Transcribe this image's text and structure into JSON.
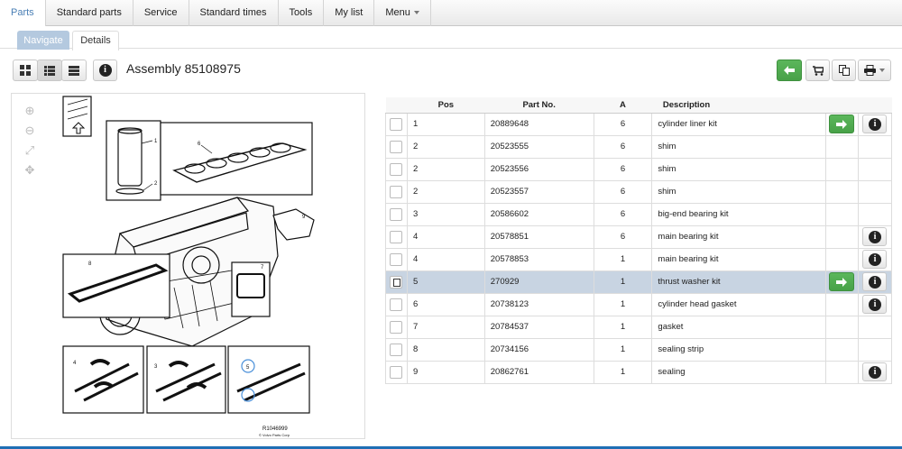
{
  "nav": {
    "tabs": [
      {
        "label": "Parts",
        "active": true
      },
      {
        "label": "Standard parts"
      },
      {
        "label": "Service"
      },
      {
        "label": "Standard times"
      },
      {
        "label": "Tools"
      },
      {
        "label": "My list"
      },
      {
        "label": "Menu",
        "dropdown": true
      }
    ]
  },
  "subtabs": {
    "navigate": "Navigate",
    "details": "Details"
  },
  "toolbar": {
    "view_icons": [
      "grid-view-icon",
      "list-view-icon",
      "compact-list-icon"
    ],
    "title": "Assembly 85108975",
    "right_icons": [
      "back-arrow-icon",
      "cart-icon",
      "copy-icon",
      "print-icon"
    ]
  },
  "drawing": {
    "code": "R1046999",
    "copyright": "© Volvo Parts Corp",
    "zoom_icons": [
      "zoom-in-icon",
      "zoom-out-icon",
      "fit-icon",
      "move-icon"
    ],
    "callouts": [
      "1",
      "2",
      "6",
      "9",
      "8",
      "7",
      "4",
      "3",
      "5"
    ]
  },
  "table": {
    "columns": {
      "pos": "Pos",
      "part": "Part No.",
      "a": "A",
      "desc": "Description"
    },
    "rows": [
      {
        "pos": "1",
        "part": "20889648",
        "a": "6",
        "desc": "cylinder liner kit",
        "arrow": true,
        "info": true
      },
      {
        "pos": "2",
        "part": "20523555",
        "a": "6",
        "desc": "shim"
      },
      {
        "pos": "2",
        "part": "20523556",
        "a": "6",
        "desc": "shim"
      },
      {
        "pos": "2",
        "part": "20523557",
        "a": "6",
        "desc": "shim"
      },
      {
        "pos": "3",
        "part": "20586602",
        "a": "6",
        "desc": "big-end bearing kit"
      },
      {
        "pos": "4",
        "part": "20578851",
        "a": "6",
        "desc": "main bearing kit",
        "info": true
      },
      {
        "pos": "4",
        "part": "20578853",
        "a": "1",
        "desc": "main bearing kit",
        "info": true
      },
      {
        "pos": "5",
        "part": "270929",
        "a": "1",
        "desc": "thrust washer kit",
        "arrow": true,
        "info": true,
        "selected": true
      },
      {
        "pos": "6",
        "part": "20738123",
        "a": "1",
        "desc": "cylinder head gasket",
        "info": true
      },
      {
        "pos": "7",
        "part": "20784537",
        "a": "1",
        "desc": "gasket"
      },
      {
        "pos": "8",
        "part": "20734156",
        "a": "1",
        "desc": "sealing strip"
      },
      {
        "pos": "9",
        "part": "20862761",
        "a": "1",
        "desc": "sealing",
        "info": true
      }
    ]
  }
}
